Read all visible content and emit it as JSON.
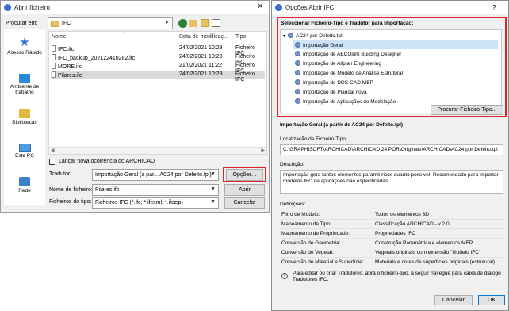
{
  "open_dialog": {
    "title": "Abrir ficheiro",
    "close_glyph": "✕",
    "look_in_label": "Procurar em:",
    "look_in_value": "IFC",
    "places": [
      {
        "label": "Acesso Rápido",
        "icon": "star-icon"
      },
      {
        "label": "Ambiente de trabalho",
        "icon": "desktop-icon"
      },
      {
        "label": "Bibliotecas",
        "icon": "libraries-icon"
      },
      {
        "label": "Este PC",
        "icon": "computer-icon"
      },
      {
        "label": "Rede",
        "icon": "network-icon"
      }
    ],
    "columns": {
      "name": "Nome",
      "date": "Data de modificaç...",
      "type": "Tipo"
    },
    "sort_glyph": "^",
    "files": [
      {
        "name": "IFC.ifc",
        "date": "24/02/2021 10:28",
        "type": "Ficheiro IFC"
      },
      {
        "name": "IFC_backup_202122410282.ifc",
        "date": "24/02/2021 10:28",
        "type": "Ficheiro IFC"
      },
      {
        "name": "MORE.ifc",
        "date": "21/02/2021 11:22",
        "type": "Ficheiro IFC"
      },
      {
        "name": "Pilares.ifc",
        "date": "24/02/2021 10:29",
        "type": "Ficheiro IFC"
      }
    ],
    "new_instance_label": "Lançar nova ocorrência do ARCHICAD",
    "translator_label": "Tradutor:",
    "translator_value": "Importação Geral (a par... AC24 por Defeito.tpl)",
    "options_button": "Opções...",
    "filename_label": "Nome de ficheiro:",
    "filename_value": "Pilares.ifc",
    "open_button": "Abrir",
    "filetype_label": "Ficheiros do tipo:",
    "filetype_value": "Ficheiros IFC (*.ifc; *.ifcxml; *.ifczip)",
    "cancel_button": "Cancelar"
  },
  "options_dialog": {
    "title": "Opções Abrir IFC",
    "help_glyph": "?",
    "select_label": "Seleccionar Ficheiro-Tipo e Tradutor para Importação:",
    "template_root": "AC24 por Defeito.tpl",
    "translators": [
      "Importação Geral",
      "Importação de AECOsim Building Designer",
      "Importação de Allplan Engineering",
      "Importação de Modelo de Análise Estrutural",
      "Importação de DDS-CAD MEP",
      "Importação de Plancal nova",
      "Importação de Aplicações de Modelação"
    ],
    "browse_button": "Procurar Ficheiro-Tipo...",
    "selected_title": "Importação Geral (a partir de AC24 por Defeito.tpl)",
    "location_label": "Localização de Ficheiro-Tipo:",
    "location_value": "C:\\GRAPHISOFT\\ARCHICAD\\ARCHICAD 24 POR\\Originais\\ARCHICAD\\AC24 por Defeito.tpl",
    "description_label": "Descrição:",
    "description_value": "Importação gera tantos elementos paramétricos quanto possível. Recomendado para importar modelos IFC de aplicações não especificadas.",
    "definitions_label": "Definições:",
    "definitions": [
      {
        "key": "Filtro de Modelo:",
        "value": "Todos os elementos 3D"
      },
      {
        "key": "Mapeamento de Tipo:",
        "value": "Classificação ARCHICAD - v 2.0"
      },
      {
        "key": "Mapeamento de Propriedade:",
        "value": "Propriedades IFC"
      },
      {
        "key": "Conversão de Geometria:",
        "value": "Construção Paramétrica e elementos MEP"
      },
      {
        "key": "Conversão de Vegetal:",
        "value": "Vegetais originais com extensão \"Modelo IFC\""
      },
      {
        "key": "Conversão de Material e Superfície:",
        "value": "Materiais e cores de superfícies originais (estrutural)"
      }
    ],
    "info_text": "Para editar ou criar Tradutores, abra o ficheiro-tipo, a seguir navegue para caixa de diálogo Tradutores IFC.",
    "cancel_button": "Cancelar",
    "ok_button": "OK"
  },
  "colors": {
    "highlight_red": "#e0252a",
    "selection_blue": "#cde3f7"
  }
}
